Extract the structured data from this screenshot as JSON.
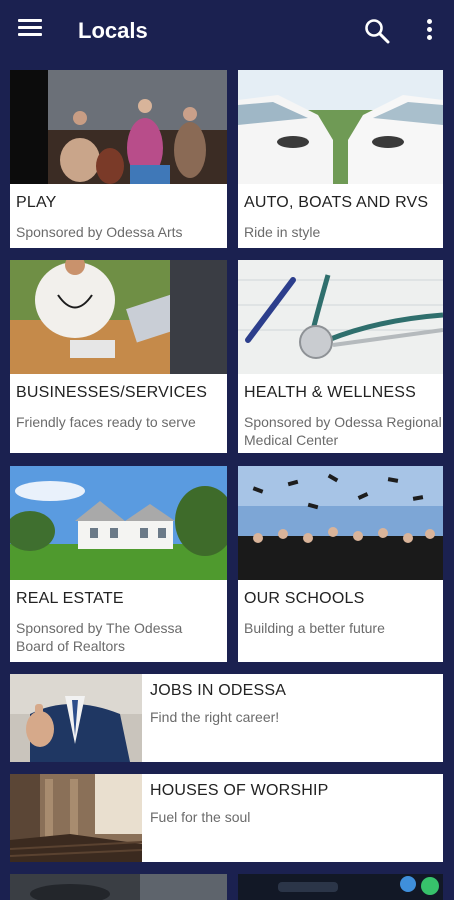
{
  "appbar": {
    "title": "Locals",
    "menu_icon": "hamburger-menu-icon",
    "search_icon": "search-icon",
    "more_icon": "more-vert-icon"
  },
  "colors": {
    "background": "#1b2150",
    "card": "#ffffff",
    "title_text": "#222222",
    "subtitle_text": "#6b6b6b"
  },
  "categories": [
    {
      "title": "PLAY",
      "subtitle": "Sponsored by Odessa Arts"
    },
    {
      "title": "AUTO, BOATS AND RVS",
      "subtitle": "Ride in style"
    },
    {
      "title": "BUSINESSES/SERVICES",
      "subtitle": "Friendly faces ready to serve"
    },
    {
      "title": "HEALTH & WELLNESS",
      "subtitle": "Sponsored by Odessa Regional Medical Center"
    },
    {
      "title": "REAL ESTATE",
      "subtitle": "Sponsored by The Odessa Board of Realtors"
    },
    {
      "title": "OUR SCHOOLS",
      "subtitle": "Building a better future"
    },
    {
      "title": "JOBS IN ODESSA",
      "subtitle": "Find the right career!"
    },
    {
      "title": "HOUSES OF WORSHIP",
      "subtitle": "Fuel for the soul"
    }
  ]
}
